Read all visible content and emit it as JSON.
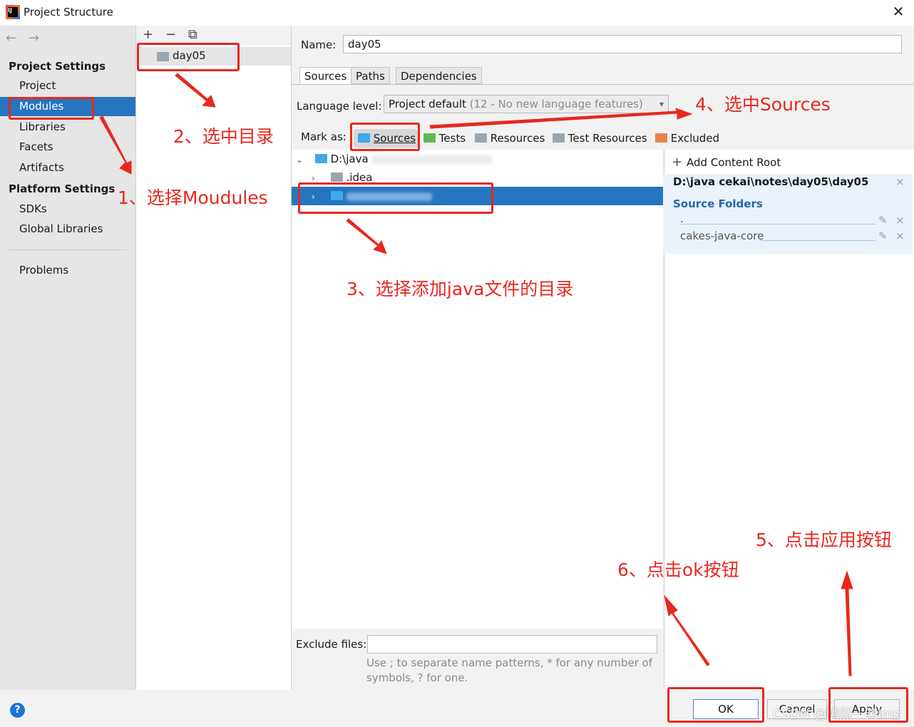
{
  "window": {
    "title": "Project Structure",
    "close": "✕"
  },
  "nav": {
    "back": "←",
    "forward": "→"
  },
  "sidebar": {
    "project_settings": "Project Settings",
    "project_items": [
      "Project",
      "Modules",
      "Libraries",
      "Facets",
      "Artifacts"
    ],
    "platform_settings": "Platform Settings",
    "platform_items": [
      "SDKs",
      "Global Libraries"
    ],
    "problems": "Problems",
    "selected": "Modules"
  },
  "modules": {
    "toolbar": {
      "add": "+",
      "remove": "−",
      "copy": "⧉"
    },
    "items": [
      "day05"
    ]
  },
  "main": {
    "name_label": "Name:",
    "name_value": "day05",
    "tabs": [
      "Sources",
      "Paths",
      "Dependencies"
    ],
    "active_tab": "Sources",
    "language_label": "Language level:",
    "language_value": "Project default",
    "language_hint": "(12 - No new language features)",
    "mark_as_label": "Mark as:",
    "mark_buttons": [
      "Sources",
      "Tests",
      "Resources",
      "Test Resources",
      "Excluded"
    ],
    "tree": {
      "root": "D:\\java",
      "child1": ".idea"
    },
    "exclude_label": "Exclude files:",
    "exclude_value": "",
    "exclude_hint_1": "Use ; to separate name patterns, * for any number of",
    "exclude_hint_2": "symbols, ? for one."
  },
  "content_root": {
    "add_label": "Add Content Root",
    "path": "D:\\java cekai\\notes\\day05\\day05",
    "source_folders_label": "Source Folders",
    "folders": [
      ".",
      "cakes-java-core"
    ]
  },
  "footer": {
    "help": "?",
    "ok": "OK",
    "cancel": "Cancel",
    "apply": "Apply"
  },
  "watermark": "CSDN @嫣然一笑lmz",
  "annotations": {
    "step1": "1、选择Moudules",
    "step2": "2、选中目录",
    "step3": "3、选择添加java文件的目录",
    "step4": "4、选中Sources",
    "step5": "5、点击应用按钮",
    "step6": "6、点击ok按钮"
  },
  "colors": {
    "selection": "#2675bf",
    "annotation": "#e8281f",
    "help": "#1d75d3"
  }
}
